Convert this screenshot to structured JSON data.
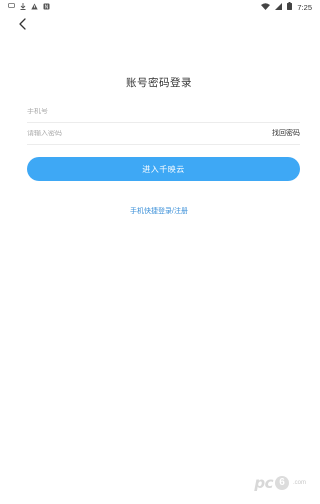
{
  "status_bar": {
    "time": "7:25",
    "left_icons": [
      "message-icon",
      "download-icon",
      "warning-icon",
      "notification-badge-icon"
    ],
    "right_icons": [
      "wifi-icon",
      "signal-icon",
      "battery-icon"
    ]
  },
  "header": {
    "back_icon": "chevron-left-icon"
  },
  "login": {
    "title": "账号密码登录",
    "phone_placeholder": "手机号",
    "password_placeholder": "请输入密码",
    "forgot_password": "找回密码",
    "submit_label": "进入千映云",
    "quick_login": "手机快捷登录/注册"
  },
  "watermark": {
    "brand": "pc",
    "badge": "6",
    "suffix": ".com"
  },
  "colors": {
    "accent": "#3ea8f5",
    "link": "#3a8fd8",
    "divider": "#ececec"
  }
}
